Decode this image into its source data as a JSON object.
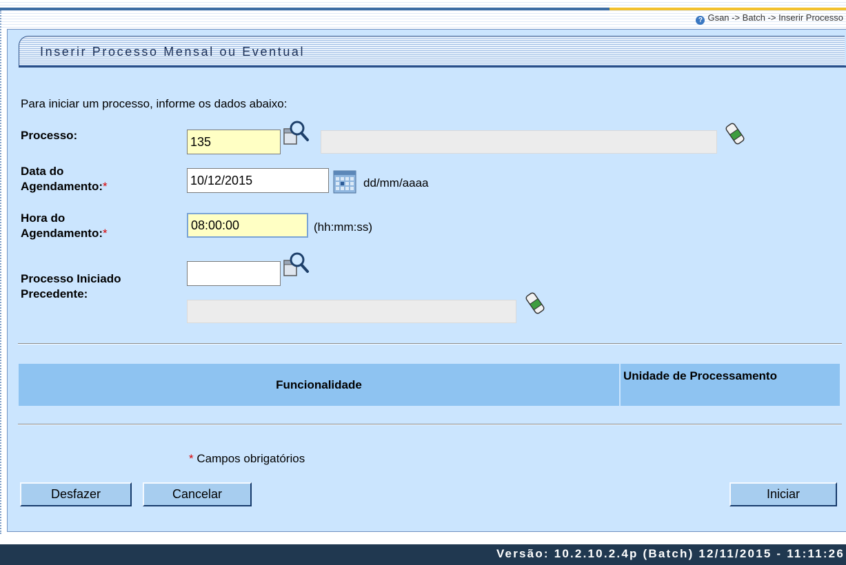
{
  "header": {
    "breadcrumb": "Gsan -> Batch -> Inserir Processo"
  },
  "page": {
    "title": "Inserir Processo Mensal ou Eventual",
    "intro": "Para iniciar um processo, informe os dados abaixo:"
  },
  "form": {
    "processo": {
      "label": "Processo:",
      "value": "135",
      "description": ""
    },
    "data_agendamento": {
      "label_line1": "Data do",
      "label_line2": "Agendamento:",
      "required_mark": "*",
      "value": "10/12/2015",
      "format_hint": "dd/mm/aaaa"
    },
    "hora_agendamento": {
      "label_line1": "Hora do",
      "label_line2": "Agendamento:",
      "required_mark": "*",
      "value": "08:00:00",
      "format_hint": "(hh:mm:ss)"
    },
    "processo_precedente": {
      "label_line1": "Processo Iniciado",
      "label_line2": "Precedente:",
      "value": "",
      "description": ""
    }
  },
  "table": {
    "columns": [
      "Funcionalidade",
      "Unidade de Processamento"
    ]
  },
  "required_note": {
    "mark": "*",
    "text": " Campos obrigatórios"
  },
  "buttons": {
    "desfazer": "Desfazer",
    "cancelar": "Cancelar",
    "iniciar": "Iniciar"
  },
  "footer": {
    "version": "Versão: 10.2.10.2.4p (Batch) 12/11/2015 - 11:11:26"
  },
  "colors": {
    "panel_bg": "#cbe5fe",
    "table_header_bg": "#8ec3f1",
    "button_bg": "#a7cdef",
    "footer_bg": "#203850",
    "required_mark": "#d80000",
    "input_highlight": "#ffffc4"
  },
  "icons": {
    "search": "magnifier-icon",
    "clear": "eraser-icon",
    "calendar": "calendar-icon",
    "help": "help-icon"
  }
}
